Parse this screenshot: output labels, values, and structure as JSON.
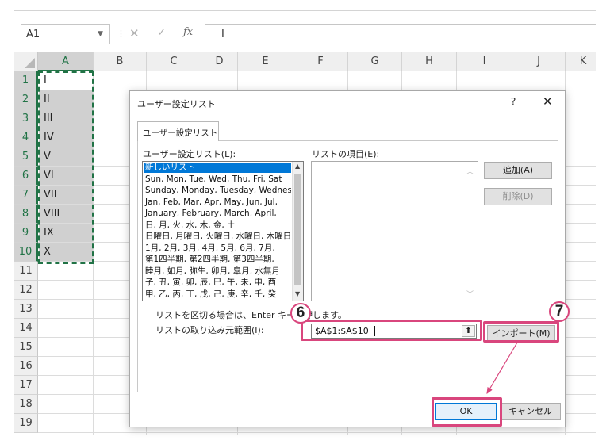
{
  "formula_bar": {
    "name_box": "A1",
    "cancel_glyph": "✕",
    "enter_glyph": "✓",
    "fx_label": "fx",
    "value": "I"
  },
  "grid": {
    "columns": [
      "A",
      "B",
      "C",
      "D",
      "E",
      "F",
      "G",
      "H",
      "I",
      "J",
      "K"
    ],
    "rows": [
      "1",
      "2",
      "3",
      "4",
      "5",
      "6",
      "7",
      "8",
      "9",
      "10",
      "11",
      "12",
      "13",
      "14",
      "15",
      "16",
      "17",
      "18",
      "19"
    ],
    "column_a_values": [
      "I",
      "II",
      "III",
      "IV",
      "V",
      "VI",
      "VII",
      "VIII",
      "IX",
      "X"
    ]
  },
  "dialog": {
    "title": "ユーザー設定リスト",
    "help": "?",
    "close": "✕",
    "tab": "ユーザー設定リスト",
    "lists_label": "ユーザー設定リスト(L):",
    "entries_label": "リストの項目(E):",
    "lists": [
      "新しいリスト",
      "Sun, Mon, Tue, Wed, Thu, Fri, Sat",
      "Sunday, Monday, Tuesday, Wednesday",
      "Jan, Feb, Mar, Apr, May, Jun, Jul,",
      "January, February, March, April,",
      "日, 月, 火, 水, 木, 金, 土",
      "日曜日, 月曜日, 火曜日, 水曜日, 木曜日",
      "1月, 2月, 3月, 4月, 5月, 6月, 7月,",
      "第1四半期, 第2四半期, 第3四半期,",
      "睦月, 如月, 弥生, 卯月, 皐月, 水無月",
      "子, 丑, 寅, 卯, 辰, 巳, 午, 未, 申, 酉",
      "甲, 乙, 丙, 丁, 戊, 己, 庚, 辛, 壬, 癸"
    ],
    "add_button": "追加(A)",
    "delete_button": "削除(D)",
    "hint": "リストを区切る場合は、Enter キーを押します。",
    "import_range_label": "リストの取り込み元範囲(I):",
    "import_range_value": "$A$1:$A$10",
    "import_button": "インポート(M)",
    "ok_button": "OK",
    "cancel_button": "キャンセル"
  },
  "annotations": {
    "step_6": "6",
    "step_7": "7",
    "highlight_color": "#d9467d"
  },
  "colors": {
    "excel_green": "#217346",
    "selection_blue": "#0078d7",
    "selected_cells": "#d0d0d0"
  }
}
